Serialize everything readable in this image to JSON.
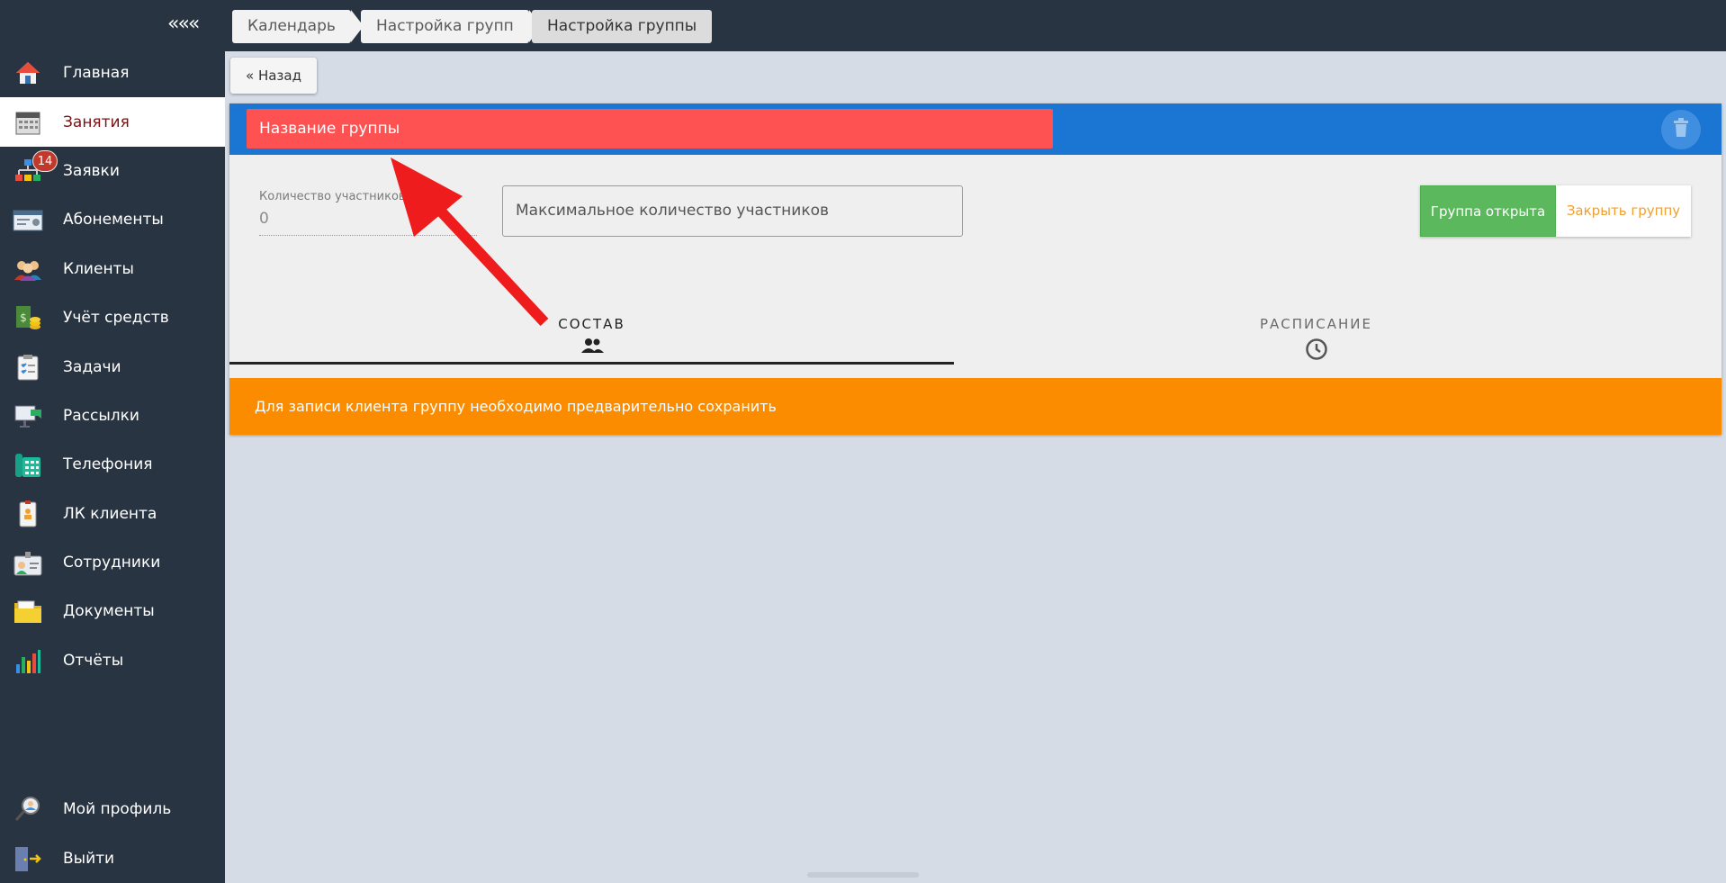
{
  "sidebar": {
    "collapse_label": "«««",
    "items": [
      {
        "label": "Главная",
        "icon": "home-icon"
      },
      {
        "label": "Занятия",
        "icon": "calendar-icon",
        "active": true
      },
      {
        "label": "Заявки",
        "icon": "requests-icon",
        "badge": "14"
      },
      {
        "label": "Абонементы",
        "icon": "subscription-card-icon"
      },
      {
        "label": "Клиенты",
        "icon": "clients-icon"
      },
      {
        "label": "Учёт средств",
        "icon": "money-icon"
      },
      {
        "label": "Задачи",
        "icon": "tasks-clipboard-icon"
      },
      {
        "label": "Рассылки",
        "icon": "mailing-icon"
      },
      {
        "label": "Телефония",
        "icon": "phone-icon"
      },
      {
        "label": "ЛК клиента",
        "icon": "client-cabinet-icon"
      },
      {
        "label": "Сотрудники",
        "icon": "employee-badge-icon"
      },
      {
        "label": "Документы",
        "icon": "documents-folder-icon"
      },
      {
        "label": "Отчёты",
        "icon": "reports-chart-icon"
      }
    ],
    "bottom_items": [
      {
        "label": "Мой профиль",
        "icon": "profile-search-icon"
      },
      {
        "label": "Выйти",
        "icon": "logout-door-icon"
      }
    ]
  },
  "breadcrumbs": [
    "Календарь",
    "Настройка групп",
    "Настройка группы"
  ],
  "back_label": "« Назад",
  "form": {
    "name_placeholder": "Название группы",
    "count_label": "Количество участников",
    "count_value": "0",
    "max_placeholder": "Максимальное количество участников",
    "open_label": "Группа открыта",
    "close_label": "Закрыть группу"
  },
  "tabs": [
    {
      "label": "СОСТАВ",
      "icon": "people-icon",
      "active": true
    },
    {
      "label": "РАСПИСАНИЕ",
      "icon": "clock-icon",
      "active": false
    }
  ],
  "notice": "Для записи клиента группу необходимо предварительно сохранить",
  "colors": {
    "sidebar_bg": "#283442",
    "header_blue": "#1b76d3",
    "name_field_red": "#fe5252",
    "open_green": "#5cb85c",
    "close_orange": "#f0a030",
    "notice_orange": "#fb8c00",
    "active_item_text": "#7b1113",
    "annotation_arrow": "#ee1c1c"
  }
}
